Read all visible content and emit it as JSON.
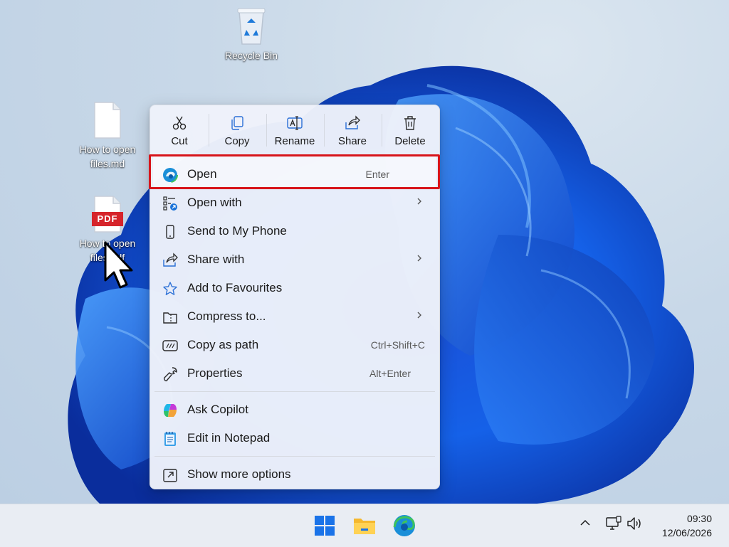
{
  "desktop": {
    "icons": [
      {
        "name": "Recycle Bin",
        "icon": "recycle-bin-icon"
      },
      {
        "name_line1": "How to open",
        "name_line2": "files.md",
        "icon": "markdown-file-icon"
      },
      {
        "name_line1": "How to open",
        "name_line2": "files.pdf",
        "icon": "pdf-file-icon",
        "badge": "PDF"
      }
    ]
  },
  "context_menu": {
    "quick_actions": [
      {
        "label": "Cut",
        "icon": "scissors-icon"
      },
      {
        "label": "Copy",
        "icon": "copy-icon"
      },
      {
        "label": "Rename",
        "icon": "rename-icon"
      },
      {
        "label": "Share",
        "icon": "share-icon"
      },
      {
        "label": "Delete",
        "icon": "trash-icon"
      }
    ],
    "items": [
      {
        "label": "Open",
        "shortcut": "Enter",
        "icon": "edge-icon",
        "highlighted": true
      },
      {
        "label": "Open with",
        "submenu": true,
        "icon": "open-with-icon"
      },
      {
        "label": "Send to My Phone",
        "icon": "phone-icon"
      },
      {
        "label": "Share with",
        "submenu": true,
        "icon": "share-icon"
      },
      {
        "label": "Add to Favourites",
        "icon": "star-icon"
      },
      {
        "label": "Compress to...",
        "submenu": true,
        "icon": "folder-zip-icon"
      },
      {
        "label": "Copy as path",
        "shortcut": "Ctrl+Shift+C",
        "icon": "copy-path-icon"
      },
      {
        "label": "Properties",
        "shortcut": "Alt+Enter",
        "icon": "wrench-icon"
      },
      {
        "label": "Ask Copilot",
        "icon": "copilot-icon"
      },
      {
        "label": "Edit in Notepad",
        "icon": "notepad-icon"
      },
      {
        "label": "Show more options",
        "icon": "show-more-icon"
      }
    ],
    "highlight_color": "#d7141a"
  },
  "taskbar": {
    "pinned": [
      "windows-start-icon",
      "file-explorer-icon",
      "edge-icon"
    ],
    "tray": [
      "chevron-up-icon",
      "network-icon",
      "volume-icon"
    ],
    "time": "09:30",
    "date": "12/06/2026"
  }
}
